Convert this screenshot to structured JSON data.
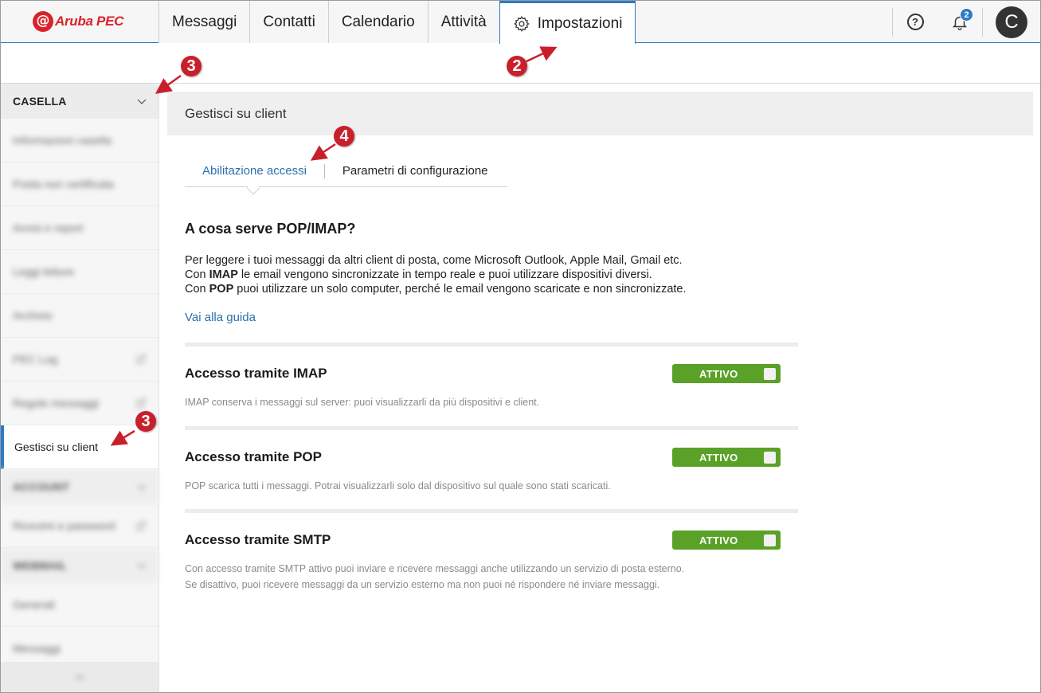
{
  "app": {
    "logo_text": "Aruba PEC"
  },
  "nav": {
    "tabs": [
      {
        "label": "Messaggi"
      },
      {
        "label": "Contatti"
      },
      {
        "label": "Calendario"
      },
      {
        "label": "Attività"
      },
      {
        "label": "Impostazioni",
        "active": true,
        "icon": "gear-icon"
      }
    ],
    "notifications_count": "2",
    "avatar_initial": "C"
  },
  "sidebar": {
    "section_casella": "CASELLA",
    "items": [
      {
        "label": "Informazioni casella",
        "blurred": true
      },
      {
        "label": "Posta non certificata",
        "blurred": true
      },
      {
        "label": "Avvisi e report",
        "blurred": true
      },
      {
        "label": "Leggi lettore",
        "blurred": true
      },
      {
        "label": "Archivio",
        "blurred": true
      },
      {
        "label": "PEC Log",
        "blurred": true,
        "external": true
      },
      {
        "label": "Regole messaggi",
        "blurred": true,
        "external": true
      },
      {
        "label": "Gestisci su client",
        "active": true
      }
    ],
    "section_account": "ACCOUNT",
    "account_items": [
      {
        "label": "Ricevimi e password",
        "blurred": true,
        "external": true
      }
    ],
    "section_webmail": "WEBMAIL",
    "webmail_items": [
      {
        "label": "Generali",
        "blurred": true
      },
      {
        "label": "Messaggi",
        "blurred": true
      }
    ]
  },
  "main": {
    "panel_title": "Gestisci su client",
    "subtabs": {
      "first": "Abilitazione accessi",
      "second": "Parametri di configurazione"
    },
    "heading": "A cosa serve POP/IMAP?",
    "para_line1": "Per leggere i tuoi messaggi da altri client di posta, come Microsoft Outlook, Apple Mail, Gmail etc.",
    "para_line2_pre": "Con ",
    "para_line2_bold": "IMAP",
    "para_line2_post": " le email vengono sincronizzate in tempo reale e puoi utilizzare dispositivi diversi.",
    "para_line3_pre": "Con ",
    "para_line3_bold": "POP",
    "para_line3_post": " puoi utilizzare un solo computer, perché le email vengono scaricate e non sincronizzate.",
    "guide_link": "Vai alla guida",
    "access": [
      {
        "title": "Accesso tramite IMAP",
        "state": "ATTIVO",
        "desc1": "IMAP conserva i messaggi sul server: puoi visualizzarli da più dispositivi e client.",
        "desc2": ""
      },
      {
        "title": "Accesso tramite POP",
        "state": "ATTIVO",
        "desc1": "POP scarica tutti i messaggi. Potrai visualizzarli solo dal dispositivo sul quale sono stati scaricati.",
        "desc2": ""
      },
      {
        "title": "Accesso tramite SMTP",
        "state": "ATTIVO",
        "desc1": "Con accesso tramite SMTP attivo puoi inviare e ricevere messaggi anche utilizzando un servizio di posta esterno.",
        "desc2": "Se disattivo, puoi ricevere messaggi da un servizio esterno ma non puoi né rispondere né inviare messaggi."
      }
    ]
  },
  "annotations": [
    "3",
    "2",
    "4",
    "3"
  ],
  "colors": {
    "accent": "#2c7bc4",
    "toggle_on": "#5aa127",
    "annotation": "#c8202b",
    "brand": "#d9222a"
  }
}
